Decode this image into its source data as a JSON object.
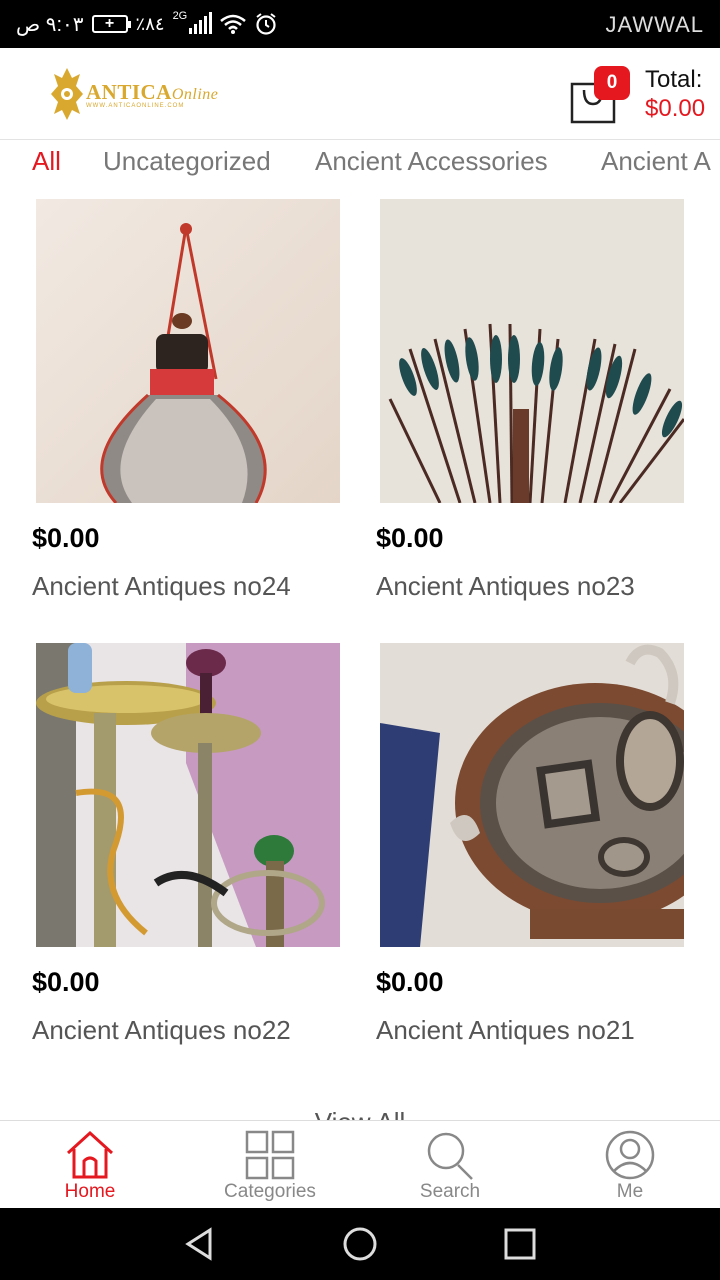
{
  "status_bar": {
    "time": "٩:٠٣ ص",
    "battery_percent": "٪٨٤",
    "network": "2G",
    "carrier": "JAWWAL"
  },
  "header": {
    "logo_name": "ANTICA",
    "logo_suffix": "Online",
    "logo_subtitle": "WWW.ANTICAONLINE.COM",
    "cart_count": "0",
    "total_label": "Total:",
    "total_value": "$0.00"
  },
  "tabs": [
    {
      "label": "All",
      "active": true
    },
    {
      "label": "Uncategorized",
      "active": false
    },
    {
      "label": "Ancient Accessories",
      "active": false
    },
    {
      "label": "Ancient A",
      "active": false
    }
  ],
  "products": [
    {
      "price": "$0.00",
      "name": "Ancient Antiques no24",
      "image_icon": "canteen-image"
    },
    {
      "price": "$0.00",
      "name": "Ancient Antiques no23",
      "image_icon": "arrows-image"
    },
    {
      "price": "$0.00",
      "name": "Ancient Antiques no22",
      "image_icon": "hookah-image"
    },
    {
      "price": "$0.00",
      "name": "Ancient Antiques no21",
      "image_icon": "ornate-frame-image"
    }
  ],
  "view_all": "View All",
  "bottom_nav": [
    {
      "label": "Home",
      "icon": "home-icon",
      "active": true
    },
    {
      "label": "Categories",
      "icon": "grid-icon",
      "active": false
    },
    {
      "label": "Search",
      "icon": "search-icon",
      "active": false
    },
    {
      "label": "Me",
      "icon": "user-icon",
      "active": false
    }
  ],
  "colors": {
    "accent": "#e5171f",
    "logo_gold": "#d9a82e",
    "status_bar": "#000000"
  }
}
